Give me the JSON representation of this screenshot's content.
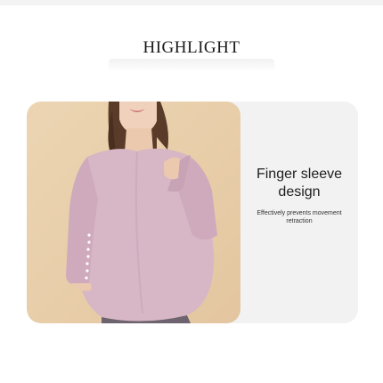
{
  "heading": {
    "title": "HIGHLIGHT"
  },
  "feature": {
    "title_line1": "Finger sleeve",
    "title_line2": "design",
    "description": "Effectively prevents movement retraction"
  },
  "colors": {
    "background": "#ffffff",
    "card": "#f2f2f2",
    "photo_backdrop": "#e8cea9",
    "shirt": "#d7b6c6"
  },
  "photo": {
    "subject": "model-wearing-pink-long-sleeve-top"
  }
}
